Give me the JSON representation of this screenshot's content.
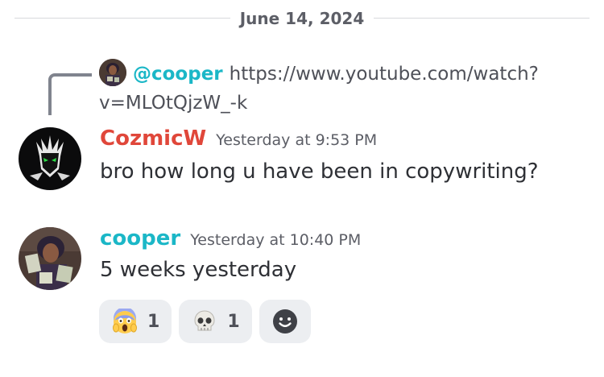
{
  "divider": {
    "date": "June 14, 2024"
  },
  "reply": {
    "mention": "@cooper",
    "text": "https://www.youtube.com/watch?v=MLOtQjzW_-k"
  },
  "messages": [
    {
      "username": "CozmicW",
      "username_color": "#e0473a",
      "timestamp": "Yesterday at 9:53 PM",
      "text": "bro how long u have been in copywriting?"
    },
    {
      "username": "cooper",
      "username_color": "#1bb7c7",
      "timestamp": "Yesterday at 10:40 PM",
      "text": "5 weeks yesterday"
    }
  ],
  "reactions": [
    {
      "emoji": "screaming-face-emoji",
      "count": "1"
    },
    {
      "emoji": "skull-emoji",
      "count": "1"
    }
  ],
  "add_reaction": {
    "icon": "smiley-face-icon"
  },
  "colors": {
    "mention": "#1bb7c7",
    "reaction_bg": "#eceef1",
    "divider_line": "#d8d9dd"
  }
}
